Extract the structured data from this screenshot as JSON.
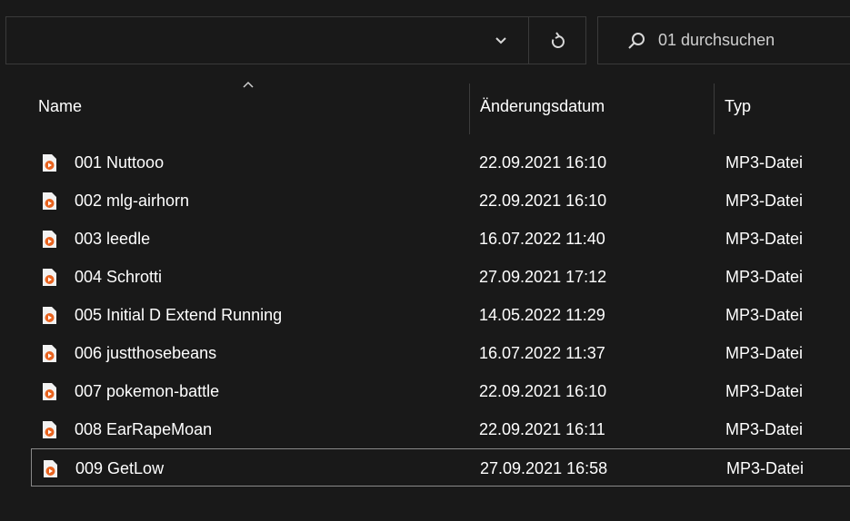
{
  "toolbar": {
    "search_placeholder": "01 durchsuchen"
  },
  "columns": {
    "name": "Name",
    "date": "Änderungsdatum",
    "type": "Typ"
  },
  "files": [
    {
      "name": "001 Nuttooo",
      "date": "22.09.2021 16:10",
      "type": "MP3-Datei"
    },
    {
      "name": "002 mlg-airhorn",
      "date": "22.09.2021 16:10",
      "type": "MP3-Datei"
    },
    {
      "name": "003 leedle",
      "date": "16.07.2022 11:40",
      "type": "MP3-Datei"
    },
    {
      "name": "004 Schrotti",
      "date": "27.09.2021 17:12",
      "type": "MP3-Datei"
    },
    {
      "name": "005 Initial D Extend Running",
      "date": "14.05.2022 11:29",
      "type": "MP3-Datei"
    },
    {
      "name": "006 justthosebeans",
      "date": "16.07.2022 11:37",
      "type": "MP3-Datei"
    },
    {
      "name": "007 pokemon-battle",
      "date": "22.09.2021 16:10",
      "type": "MP3-Datei"
    },
    {
      "name": "008 EarRapeMoan",
      "date": "22.09.2021 16:11",
      "type": "MP3-Datei"
    },
    {
      "name": "009 GetLow",
      "date": "27.09.2021 16:58",
      "type": "MP3-Datei",
      "selected": true
    }
  ],
  "icons": {
    "dropdown": "chevron-down-icon",
    "refresh": "refresh-icon",
    "search": "search-icon",
    "sort": "sort-ascending-icon",
    "file": "mp3-file-icon"
  },
  "colors": {
    "background": "#191919",
    "border": "#3a3a3a",
    "text": "#ffffff",
    "file_icon_accent": "#e8631f"
  }
}
